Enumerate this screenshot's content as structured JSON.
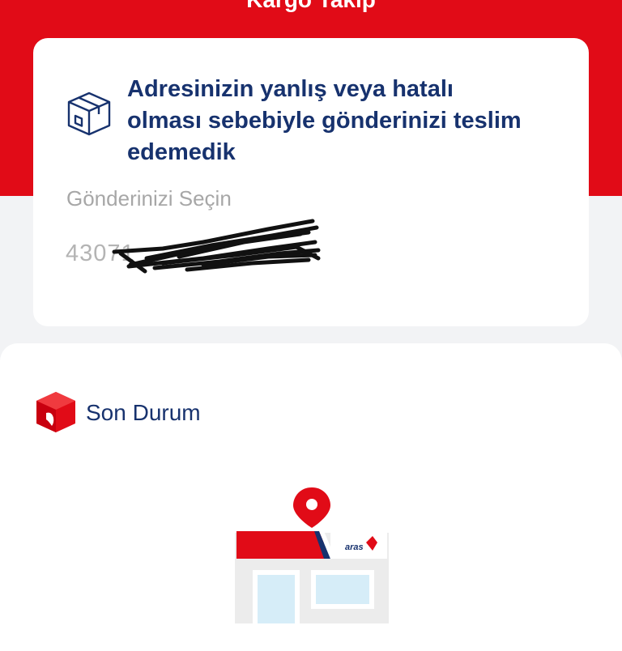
{
  "header": {
    "title": "Kargo Takip"
  },
  "status_card": {
    "message": "Adresinizin yanlış veya hatalı olması sebebiyle gönderinizi teslim edemedik",
    "select_label": "Gönderinizi Seçin",
    "tracking_number_visible": "43071",
    "icon": "package-box-icon"
  },
  "latest_status": {
    "title": "Son Durum",
    "icon": "red-box-icon"
  },
  "illustration": {
    "icon": "branch-store-icon",
    "brand_text": "aras",
    "colors": {
      "red": "#e10b17",
      "navy": "#17326e",
      "window": "#d6edf8",
      "wall": "#ececec"
    }
  },
  "colors": {
    "brand_red": "#e10b17",
    "navy_text": "#17326e",
    "muted_text": "#a7a7a7",
    "background": "#f2f3f5"
  }
}
